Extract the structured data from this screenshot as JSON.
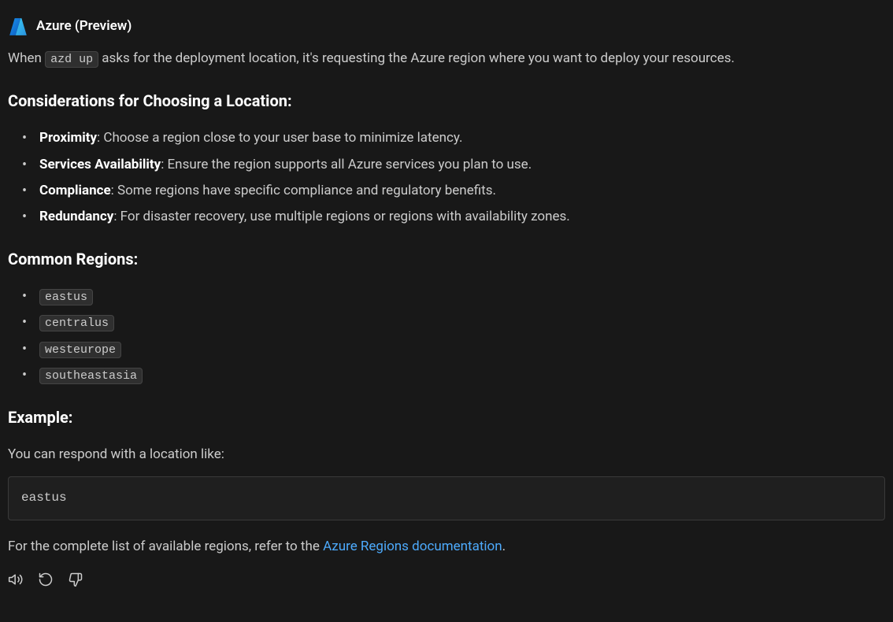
{
  "header": {
    "title": "Azure (Preview)"
  },
  "intro": {
    "before_code": "When ",
    "code": "azd up",
    "after_code": " asks for the deployment location, it's requesting the Azure region where you want to deploy your resources."
  },
  "sections": {
    "considerations": {
      "heading": "Considerations for Choosing a Location:",
      "items": [
        {
          "label": "Proximity",
          "text": ": Choose a region close to your user base to minimize latency."
        },
        {
          "label": "Services Availability",
          "text": ": Ensure the region supports all Azure services you plan to use."
        },
        {
          "label": "Compliance",
          "text": ": Some regions have specific compliance and regulatory benefits."
        },
        {
          "label": "Redundancy",
          "text": ": For disaster recovery, use multiple regions or regions with availability zones."
        }
      ]
    },
    "common_regions": {
      "heading": "Common Regions:",
      "items": [
        "eastus",
        "centralus",
        "westeurope",
        "southeastasia"
      ]
    },
    "example": {
      "heading": "Example:",
      "lead": "You can respond with a location like:",
      "code": "eastus"
    }
  },
  "footer": {
    "before_link": "For the complete list of available regions, refer to the ",
    "link_text": "Azure Regions documentation",
    "after_link": "."
  }
}
